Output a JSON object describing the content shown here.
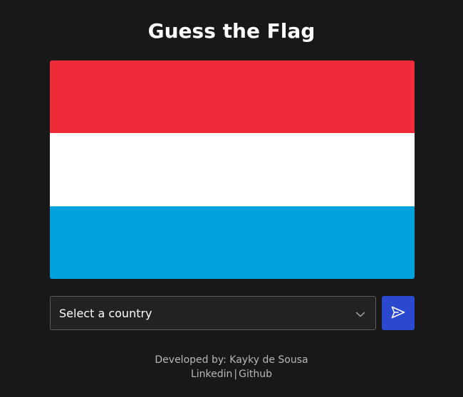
{
  "header": {
    "title": "Guess the Flag"
  },
  "flag": {
    "stripes": [
      "#ef2b3a",
      "#ffffff",
      "#00a2de"
    ]
  },
  "guess": {
    "select_value": "Select a country",
    "submit_icon": "send-icon"
  },
  "footer": {
    "credit": "Developed by: Kayky de Sousa",
    "links": [
      "Linkedin",
      "Github"
    ],
    "separator": "|"
  },
  "colors": {
    "background": "#181818",
    "accent": "#2a49cf"
  }
}
